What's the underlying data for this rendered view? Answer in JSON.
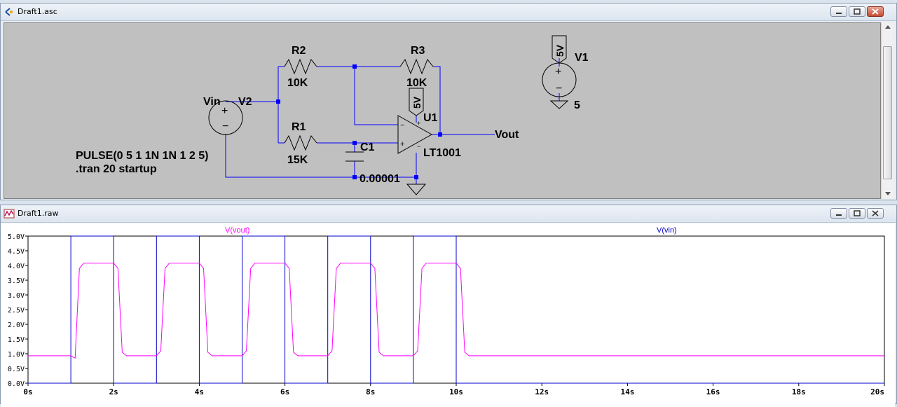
{
  "schematic_window": {
    "title": "Draft1.asc",
    "netlist": {
      "vin_label": "Vin",
      "v2_label": "V2",
      "r2_name": "R2",
      "r2_value": "10K",
      "r3_name": "R3",
      "r3_value": "10K",
      "r1_name": "R1",
      "r1_value": "15K",
      "c1_name": "C1",
      "c1_value": "0.00001",
      "u1_name": "U1",
      "u1_model": "LT1001",
      "supply_flag": "5V",
      "v1_flag": "5V",
      "v1_name": "V1",
      "v1_value": "5",
      "vout_label": "Vout",
      "pulse_directive": "PULSE(0 5 1 1N 1N 1 2 5)",
      "tran_directive": ".tran 20 startup"
    }
  },
  "plot_window": {
    "title": "Draft1.raw",
    "trace_vout_label": "V(vout)",
    "trace_vin_label": "V(vin)",
    "colors": {
      "vout": "#ff00ff",
      "vin": "#0000cc",
      "axis": "#000000",
      "wire": "#0000ff",
      "junction": "#0000ff"
    }
  },
  "chart_data": {
    "type": "line",
    "xlabel": "",
    "ylabel": "",
    "xlim": [
      0,
      20
    ],
    "ylim": [
      0,
      5
    ],
    "x_ticks": [
      "0s",
      "2s",
      "4s",
      "6s",
      "8s",
      "10s",
      "12s",
      "14s",
      "16s",
      "18s",
      "20s"
    ],
    "y_ticks": [
      "0.0V",
      "0.5V",
      "1.0V",
      "1.5V",
      "2.0V",
      "2.5V",
      "3.0V",
      "3.5V",
      "4.0V",
      "4.5V",
      "5.0V"
    ],
    "series": [
      {
        "name": "V(vout)",
        "x": [
          0,
          1,
          1.1,
          1.2,
          1.3,
          2.0,
          2.1,
          2.2,
          2.3,
          3.0,
          3.1,
          3.2,
          3.3,
          4.0,
          4.1,
          4.2,
          4.3,
          5.0,
          5.1,
          5.2,
          5.3,
          6.0,
          6.1,
          6.2,
          6.3,
          7.0,
          7.1,
          7.2,
          7.3,
          8.0,
          8.1,
          8.2,
          8.3,
          9.0,
          9.1,
          9.2,
          9.3,
          10.0,
          10.1,
          10.2,
          10.3,
          20
        ],
        "y": [
          0.93,
          0.93,
          0.85,
          3.9,
          4.08,
          4.08,
          3.9,
          1.05,
          0.93,
          0.93,
          1.1,
          3.9,
          4.08,
          4.08,
          3.9,
          1.05,
          0.93,
          0.93,
          1.1,
          3.9,
          4.08,
          4.08,
          3.9,
          1.05,
          0.93,
          0.93,
          1.1,
          3.9,
          4.08,
          4.08,
          3.9,
          1.05,
          0.93,
          0.93,
          1.1,
          3.9,
          4.08,
          4.08,
          3.9,
          1.05,
          0.93,
          0.93
        ]
      },
      {
        "name": "V(vin)",
        "x": [
          0,
          1,
          1,
          2,
          2,
          3,
          3,
          4,
          4,
          5,
          5,
          6,
          6,
          7,
          7,
          8,
          8,
          9,
          9,
          10,
          10,
          20
        ],
        "y": [
          0,
          0,
          5,
          5,
          0,
          0,
          5,
          5,
          0,
          0,
          5,
          5,
          0,
          0,
          5,
          5,
          0,
          0,
          5,
          5,
          0,
          0
        ]
      }
    ]
  }
}
